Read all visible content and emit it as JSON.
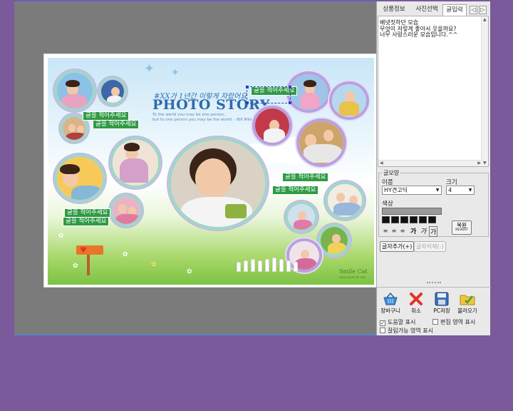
{
  "canvas": {
    "page_tagline": "#XX가 1년간 이렇게 자랐어요",
    "page_title": "PHOTO STORY",
    "quote_line1": "To the world you may be one person,",
    "quote_line2": "but to one person you may be the world. - Bill Wilson -",
    "watermark": "Smile Cat",
    "watermark_url": "www.smilecat.com",
    "placeholder_label": "글을 적어주세요",
    "selected_label": "글을 적어주세요"
  },
  "panel": {
    "tabs": [
      {
        "label": "상품정보"
      },
      {
        "label": "사진선택"
      },
      {
        "label": "글입력"
      }
    ],
    "tab_prev": "◁",
    "tab_next": "▷",
    "editor_lines": [
      "배냇짓하던 모습",
      "무엇이 저렇게 좋아서 웃을까요?",
      "너무 사랑스러운 모습입니다.^^"
    ],
    "glyph_section_title": "글모양",
    "font_name_label": "이름",
    "font_name_value": "HY견고딕",
    "font_size_label": "크기",
    "font_size_value": "4",
    "color_label": "색상",
    "restore_label_ko": "복원",
    "restore_label_en": "REVERT",
    "bold_glyph": "가",
    "italic_glyph": "가",
    "outline_glyph": "가",
    "add_text_button": "글자추가(+)",
    "delete_text_button": "글자삭제(-)",
    "tools": [
      {
        "label": "장바구니",
        "icon": "basket-icon"
      },
      {
        "label": "취소",
        "icon": "cancel-x-icon"
      },
      {
        "label": "PC저장",
        "icon": "floppy-disk-icon"
      },
      {
        "label": "불러오기",
        "icon": "folder-load-icon"
      }
    ],
    "show_help": "도움말 표시",
    "show_help_checked": "✓",
    "show_edit_area": "편집 영역 표시",
    "show_cut_area": "잘림가능 영역 표시"
  },
  "colors": {
    "background": "#7a5a9a",
    "canvas_gray": "#7b7b7b",
    "label_green": "#2f9a44",
    "title_blue": "#2e6aa8",
    "selection_blue": "#2a3ed0"
  }
}
